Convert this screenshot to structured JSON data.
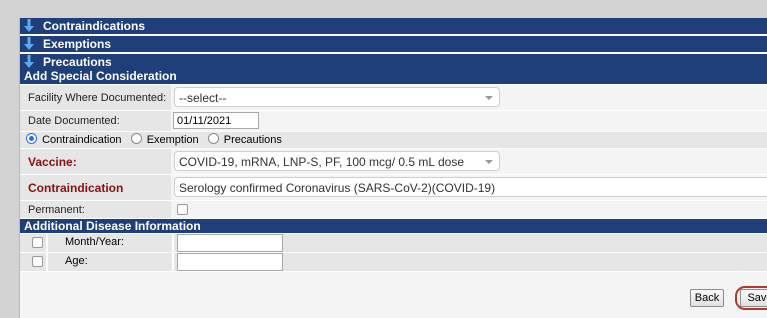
{
  "sections": {
    "contraindications": "Contraindications",
    "exemptions": "Exemptions",
    "precautions": "Precautions"
  },
  "special": {
    "header": "Add Special Consideration",
    "facility_label": "Facility Where Documented:",
    "facility_value": "--select--",
    "date_label": "Date Documented:",
    "date_value": "01/11/2021",
    "radio_options": [
      "Contraindication",
      "Exemption",
      "Precautions"
    ],
    "radio_selected": "Contraindication",
    "vaccine_label": "Vaccine:",
    "vaccine_value": "COVID-19, mRNA, LNP-S, PF, 100 mcg/ 0.5 mL dose",
    "contra_label": "Contraindication",
    "contra_value": "Serology confirmed Coronavirus (SARS-CoV-2)(COVID-19)",
    "permanent_label": "Permanent:"
  },
  "disease": {
    "header": "Additional Disease Information",
    "month_label": "Month/Year:",
    "age_label": "Age:"
  },
  "buttons": {
    "back": "Back",
    "save": "Save"
  },
  "colors": {
    "header_bg": "#1e3f7a",
    "label_red": "#8b1010",
    "callout": "#b03a2e"
  }
}
